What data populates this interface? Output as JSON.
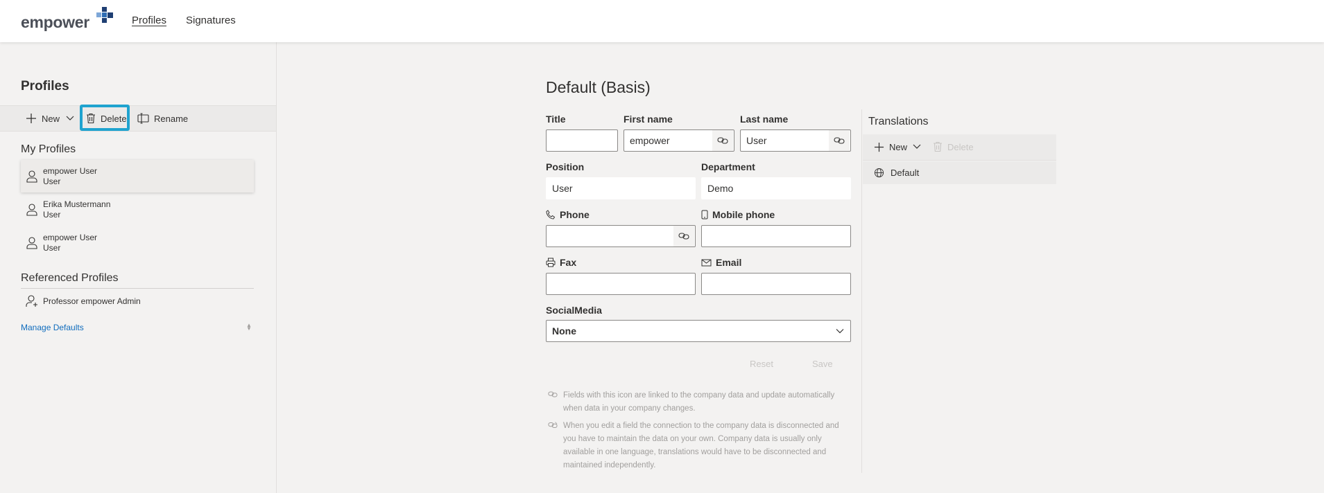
{
  "header": {
    "logo_text": "empower",
    "nav": [
      {
        "label": "Profiles",
        "active": true
      },
      {
        "label": "Signatures",
        "active": false
      }
    ]
  },
  "sidebar": {
    "title": "Profiles",
    "commands": {
      "new": "New",
      "delete": "Delete",
      "rename": "Rename"
    },
    "my_profiles_heading": "My Profiles",
    "my_profiles": [
      {
        "name": "empower User",
        "role": "User",
        "selected": true
      },
      {
        "name": "Erika Mustermann",
        "role": "User",
        "selected": false
      },
      {
        "name": "empower User",
        "role": "User",
        "selected": false
      }
    ],
    "referenced_heading": "Referenced Profiles",
    "referenced": [
      {
        "name": "Professor empower Admin"
      }
    ],
    "manage_defaults": "Manage Defaults"
  },
  "form": {
    "title": "Default (Basis)",
    "labels": {
      "title": "Title",
      "first_name": "First name",
      "last_name": "Last name",
      "position": "Position",
      "department": "Department",
      "phone": "Phone",
      "mobile": "Mobile phone",
      "fax": "Fax",
      "email": "Email",
      "social": "SocialMedia"
    },
    "values": {
      "title": "",
      "first_name": "empower",
      "last_name": "User",
      "position": "User",
      "department": "Demo",
      "phone": "",
      "mobile": "",
      "fax": "",
      "email": "",
      "social": "None"
    },
    "buttons": {
      "reset": "Reset",
      "save": "Save"
    },
    "hint_linked": "Fields with this icon are linked to the company data and update automatically when data in your company changes.",
    "hint_unlinked": "When you edit a field the connection to the company data is disconnected and you have to maintain the data on your own. Company data is usually only available in one language, translations would have to be disconnected and maintained independently."
  },
  "translations": {
    "title": "Translations",
    "commands": {
      "new": "New",
      "delete": "Delete"
    },
    "items": [
      {
        "label": "Default"
      }
    ]
  },
  "colors": {
    "accent_frame": "#1fa3cf",
    "logo_blue": "#1f3f73",
    "link": "#0f6cbd"
  }
}
